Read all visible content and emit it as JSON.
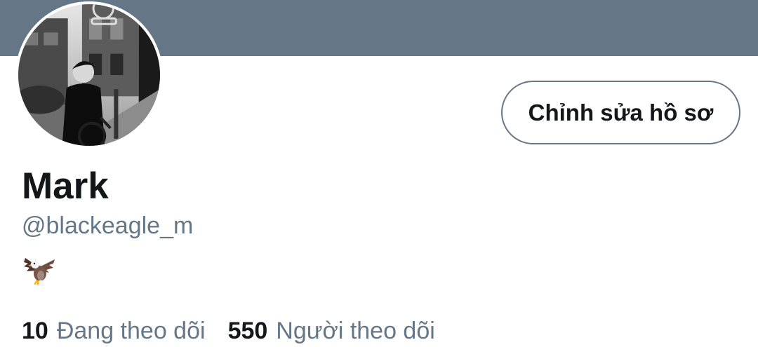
{
  "profile": {
    "display_name": "Mark",
    "handle": "@blackeagle_m",
    "bio_icon": "eagle-icon"
  },
  "actions": {
    "edit_profile_label": "Chỉnh sửa hồ sơ"
  },
  "stats": {
    "following_count": "10",
    "following_label": "Đang theo dõi",
    "followers_count": "550",
    "followers_label": "Người theo dõi"
  },
  "colors": {
    "banner": "#657786",
    "text_primary": "#14171a",
    "text_secondary": "#657786",
    "button_border": "#657786",
    "background": "#ffffff"
  }
}
